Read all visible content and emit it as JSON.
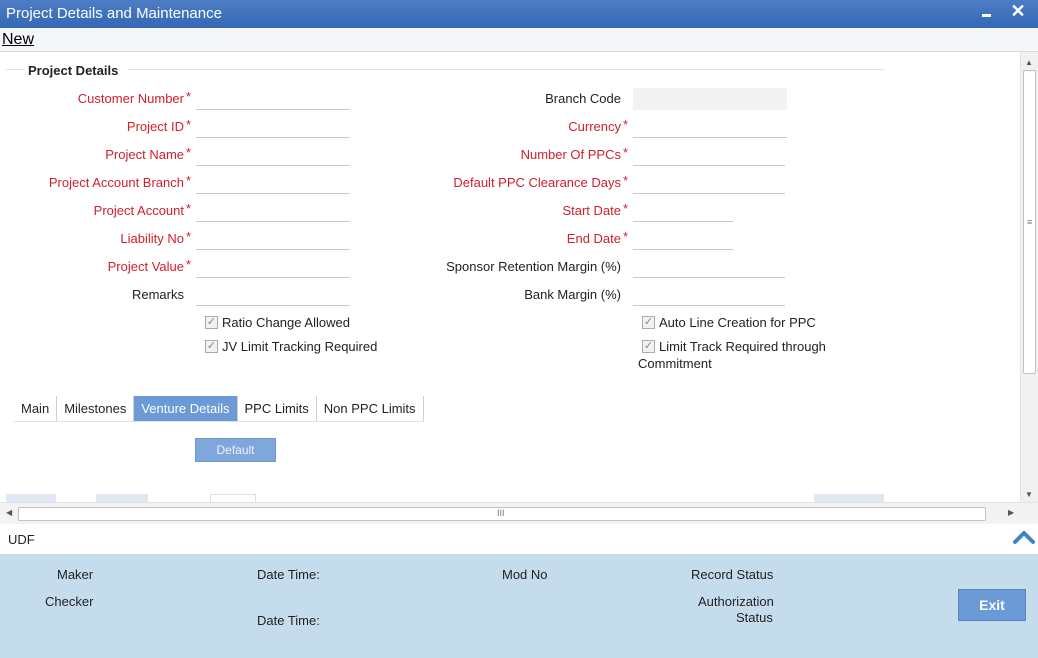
{
  "window": {
    "title": "Project Details and Maintenance"
  },
  "menu": {
    "new_label": "New"
  },
  "section": {
    "title": "Project Details"
  },
  "left_fields": [
    {
      "label": "Customer Number",
      "required": true,
      "value": ""
    },
    {
      "label": "Project ID",
      "required": true,
      "value": ""
    },
    {
      "label": "Project Name",
      "required": true,
      "value": ""
    },
    {
      "label": "Project Account Branch",
      "required": true,
      "value": ""
    },
    {
      "label": "Project Account",
      "required": true,
      "value": ""
    },
    {
      "label": "Liability No",
      "required": true,
      "value": ""
    },
    {
      "label": "Project Value",
      "required": true,
      "value": ""
    },
    {
      "label": "Remarks",
      "required": false,
      "value": ""
    }
  ],
  "right_fields": [
    {
      "label": "Branch Code",
      "required": false,
      "value": ""
    },
    {
      "label": "Currency",
      "required": true,
      "value": ""
    },
    {
      "label": "Number Of PPCs",
      "required": true,
      "value": ""
    },
    {
      "label": "Default PPC Clearance Days",
      "required": true,
      "value": ""
    },
    {
      "label": "Start Date",
      "required": true,
      "value": ""
    },
    {
      "label": "End Date",
      "required": true,
      "value": ""
    },
    {
      "label": "Sponsor Retention Margin (%)",
      "required": false,
      "value": ""
    },
    {
      "label": "Bank Margin (%)",
      "required": false,
      "value": ""
    }
  ],
  "required_mark": "*",
  "checkboxes": {
    "ratio_change_allowed": {
      "label": "Ratio Change Allowed",
      "checked": true
    },
    "jv_limit_tracking": {
      "label": "JV Limit Tracking Required",
      "checked": true
    },
    "auto_line_creation": {
      "label": "Auto Line Creation for PPC",
      "checked": true
    },
    "limit_track_commitment": {
      "label_line1": "Limit Track Required through",
      "label_line2": "Commitment",
      "checked": true
    }
  },
  "check_glyph": "✓",
  "tabs": [
    "Main",
    "Milestones",
    "Venture Details",
    "PPC Limits",
    "Non PPC Limits"
  ],
  "active_tab": "Venture Details",
  "default_button_label": "Default",
  "scroll": {
    "up": "▲",
    "down": "▼",
    "left": "◀",
    "right": "▶",
    "vgrip": "≡",
    "hgrip": "III"
  },
  "udf": {
    "label": "UDF",
    "icon": "chevron-up-icon"
  },
  "audit": {
    "maker": "Maker",
    "checker": "Checker",
    "date_time_1": "Date Time:",
    "date_time_2": "Date Time:",
    "mod_no": "Mod No",
    "record_status": "Record Status",
    "authorization_line1": "Authorization",
    "authorization_line2": "Status"
  },
  "exit_button_label": "Exit",
  "window_controls": {
    "close": "✕"
  },
  "colors": {
    "title_bar": "#3f73bd",
    "required_label": "#d0202c",
    "active_tab": "#6b9ad6",
    "footer": "#c5dced",
    "exit_button": "#6b9ad6"
  }
}
